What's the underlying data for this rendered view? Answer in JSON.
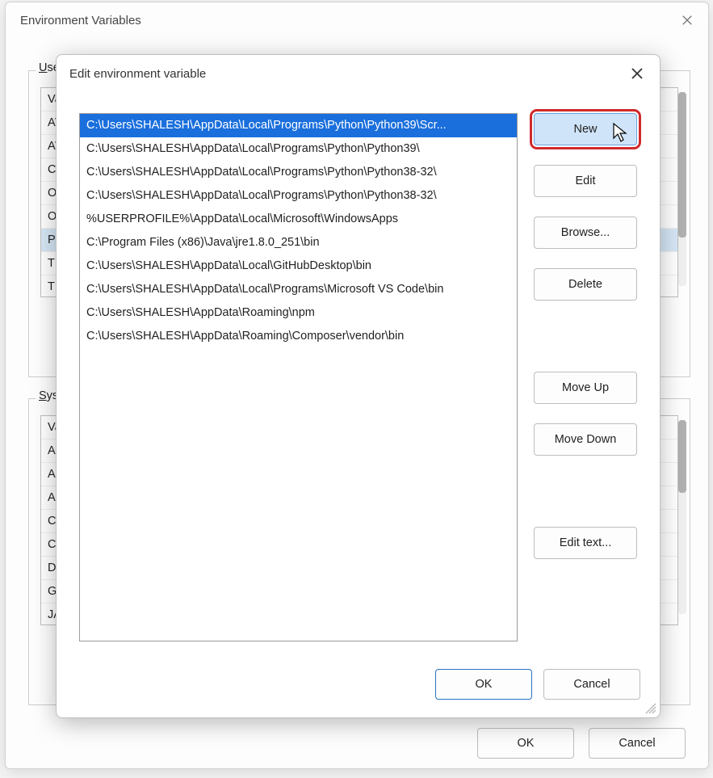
{
  "env_dialog": {
    "title": "Environment Variables",
    "user_label_prefix": "U",
    "user_label_rest": "ser",
    "system_label_prefix": "S",
    "system_label_rest": "yste",
    "user_vars": [
      "Va",
      "AW",
      "AW",
      "ChocolateyInstall",
      "OneDrive",
      "OneDriveConsumer",
      "Path",
      "TEMP",
      "TMP"
    ],
    "user_var_names_visible": [
      "Va",
      "AW",
      "AW",
      "Ch",
      "On",
      "On",
      "Pat",
      "TEI",
      "TM"
    ],
    "system_var_names_visible": [
      "Va",
      "AN",
      "AN",
      "AN",
      "Ch",
      "Co",
      "Dri",
      "GR",
      "JAV"
    ],
    "user_selected_index": 6,
    "buttons": {
      "ok": "OK",
      "cancel": "Cancel"
    }
  },
  "edit_dialog": {
    "title": "Edit environment variable",
    "selected_index": 0,
    "paths": [
      "C:\\Users\\SHALESH\\AppData\\Local\\Programs\\Python\\Python39\\Scr...",
      "C:\\Users\\SHALESH\\AppData\\Local\\Programs\\Python\\Python39\\",
      "C:\\Users\\SHALESH\\AppData\\Local\\Programs\\Python\\Python38-32\\",
      "C:\\Users\\SHALESH\\AppData\\Local\\Programs\\Python\\Python38-32\\",
      "%USERPROFILE%\\AppData\\Local\\Microsoft\\WindowsApps",
      "C:\\Program Files (x86)\\Java\\jre1.8.0_251\\bin",
      "C:\\Users\\SHALESH\\AppData\\Local\\GitHubDesktop\\bin",
      "C:\\Users\\SHALESH\\AppData\\Local\\Programs\\Microsoft VS Code\\bin",
      "C:\\Users\\SHALESH\\AppData\\Roaming\\npm",
      "C:\\Users\\SHALESH\\AppData\\Roaming\\Composer\\vendor\\bin"
    ],
    "buttons": {
      "new": "New",
      "edit": "Edit",
      "browse": "Browse...",
      "delete": "Delete",
      "move_up": "Move Up",
      "move_down": "Move Down",
      "edit_text": "Edit text...",
      "ok": "OK",
      "cancel": "Cancel"
    }
  }
}
